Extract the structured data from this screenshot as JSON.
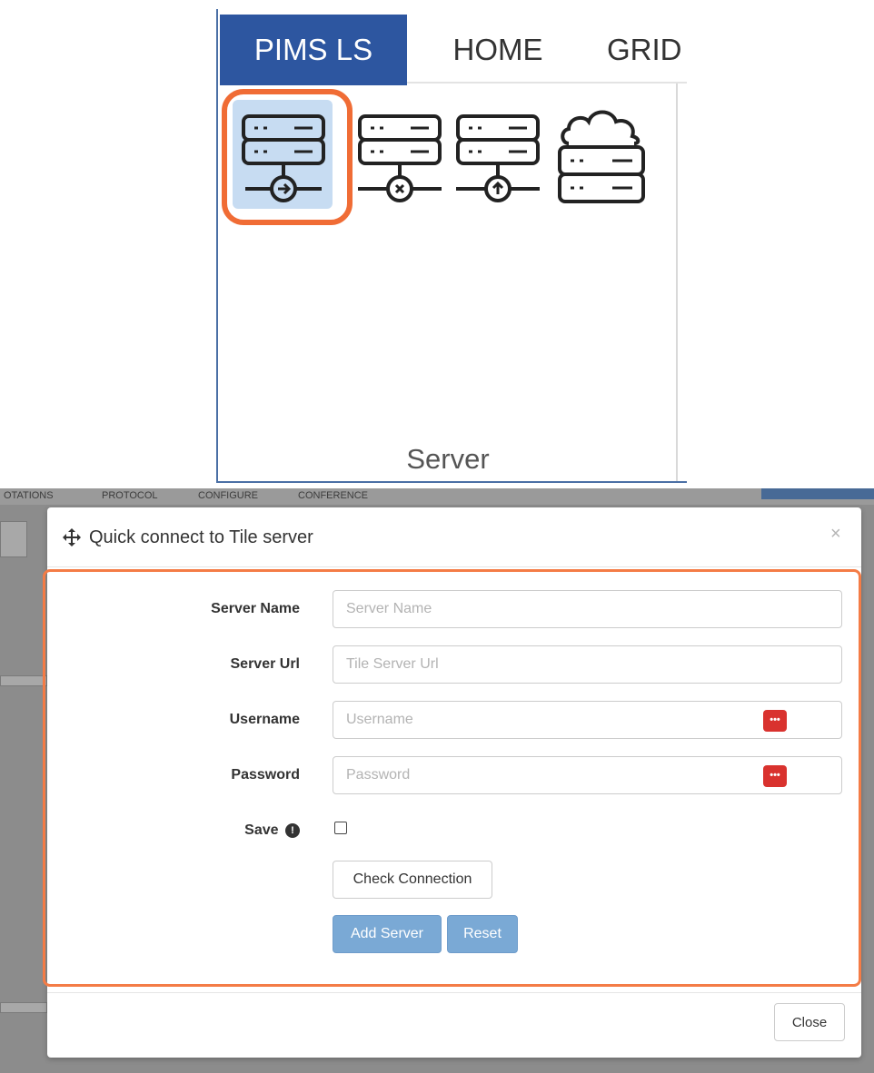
{
  "ribbon": {
    "tabs": [
      {
        "label": "PIMS LS",
        "active": true
      },
      {
        "label": "HOME",
        "active": false
      },
      {
        "label": "GRID",
        "active": false
      }
    ],
    "group_label": "Server",
    "buttons": [
      {
        "icon": "server-connect-icon",
        "selected": true
      },
      {
        "icon": "server-disconnect-icon",
        "selected": false
      },
      {
        "icon": "server-upload-icon",
        "selected": false
      },
      {
        "icon": "cloud-server-icon",
        "selected": false
      }
    ],
    "accent_color": "#2d56a0",
    "highlight_color": "#f06c35"
  },
  "background_app": {
    "tabs": [
      "OTATIONS",
      "PROTOCOL",
      "CONFIGURE",
      "CONFERENCE"
    ]
  },
  "dialog": {
    "title": "Quick connect to Tile server",
    "close_symbol": "×",
    "fields": [
      {
        "label": "Server Name",
        "placeholder": "Server Name",
        "value": ""
      },
      {
        "label": "Server Url",
        "placeholder": "Tile Server Url",
        "value": ""
      },
      {
        "label": "Username",
        "placeholder": "Username",
        "value": ""
      },
      {
        "label": "Password",
        "placeholder": "Password",
        "value": ""
      }
    ],
    "key_icon_text": "•••",
    "save_label": "Save",
    "save_checked": false,
    "info_symbol": "!",
    "buttons": {
      "check_connection": "Check Connection",
      "add_server": "Add Server",
      "reset": "Reset",
      "close": "Close"
    },
    "primary_color": "#7aa9d5",
    "outline_color": "#f47c46"
  }
}
